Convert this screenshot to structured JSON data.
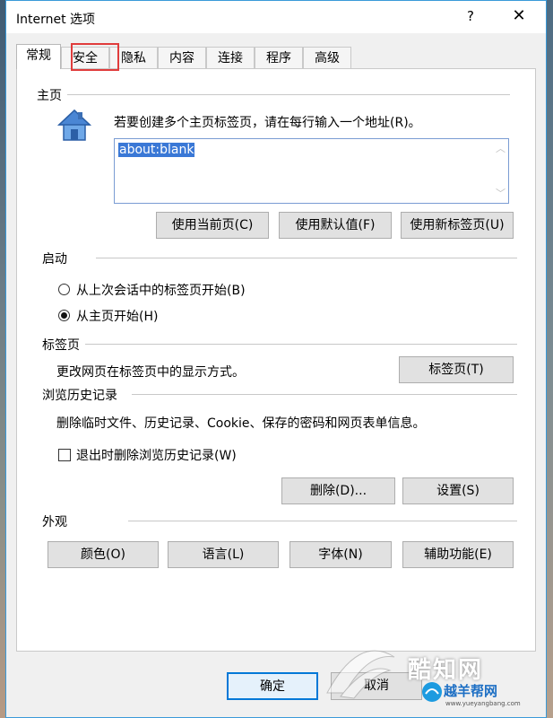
{
  "window": {
    "title": "Internet 选项",
    "help": "?",
    "close": "✕"
  },
  "tabs": [
    "常规",
    "安全",
    "隐私",
    "内容",
    "连接",
    "程序",
    "高级"
  ],
  "home": {
    "section": "主页",
    "instruction": "若要创建多个主页标签页，请在每行输入一个地址(R)。",
    "address": "about:blank",
    "btn_current": "使用当前页(C)",
    "btn_default": "使用默认值(F)",
    "btn_newtab": "使用新标签页(U)"
  },
  "startup": {
    "section": "启动",
    "opt_last_session": "从上次会话中的标签页开始(B)",
    "opt_homepage": "从主页开始(H)",
    "selected": "opt_homepage"
  },
  "tabsection": {
    "section": "标签页",
    "desc": "更改网页在标签页中的显示方式。",
    "btn": "标签页(T)"
  },
  "history": {
    "section": "浏览历史记录",
    "desc": "删除临时文件、历史记录、Cookie、保存的密码和网页表单信息。",
    "checkbox": "退出时删除浏览历史记录(W)",
    "checked": false,
    "btn_delete": "删除(D)...",
    "btn_settings": "设置(S)"
  },
  "appearance": {
    "section": "外观",
    "btn_colors": "颜色(O)",
    "btn_language": "语言(L)",
    "btn_fonts": "字体(N)",
    "btn_accessibility": "辅助功能(E)"
  },
  "footer": {
    "ok": "确定",
    "cancel": "取消"
  },
  "watermark": {
    "brand": "酷知网",
    "brand2": "越羊帮网",
    "url": "www.yueyangbang.com"
  },
  "colors": {
    "accent": "#0078d7",
    "highlight_box": "#e03c3c",
    "selection": "#3a78d6"
  }
}
